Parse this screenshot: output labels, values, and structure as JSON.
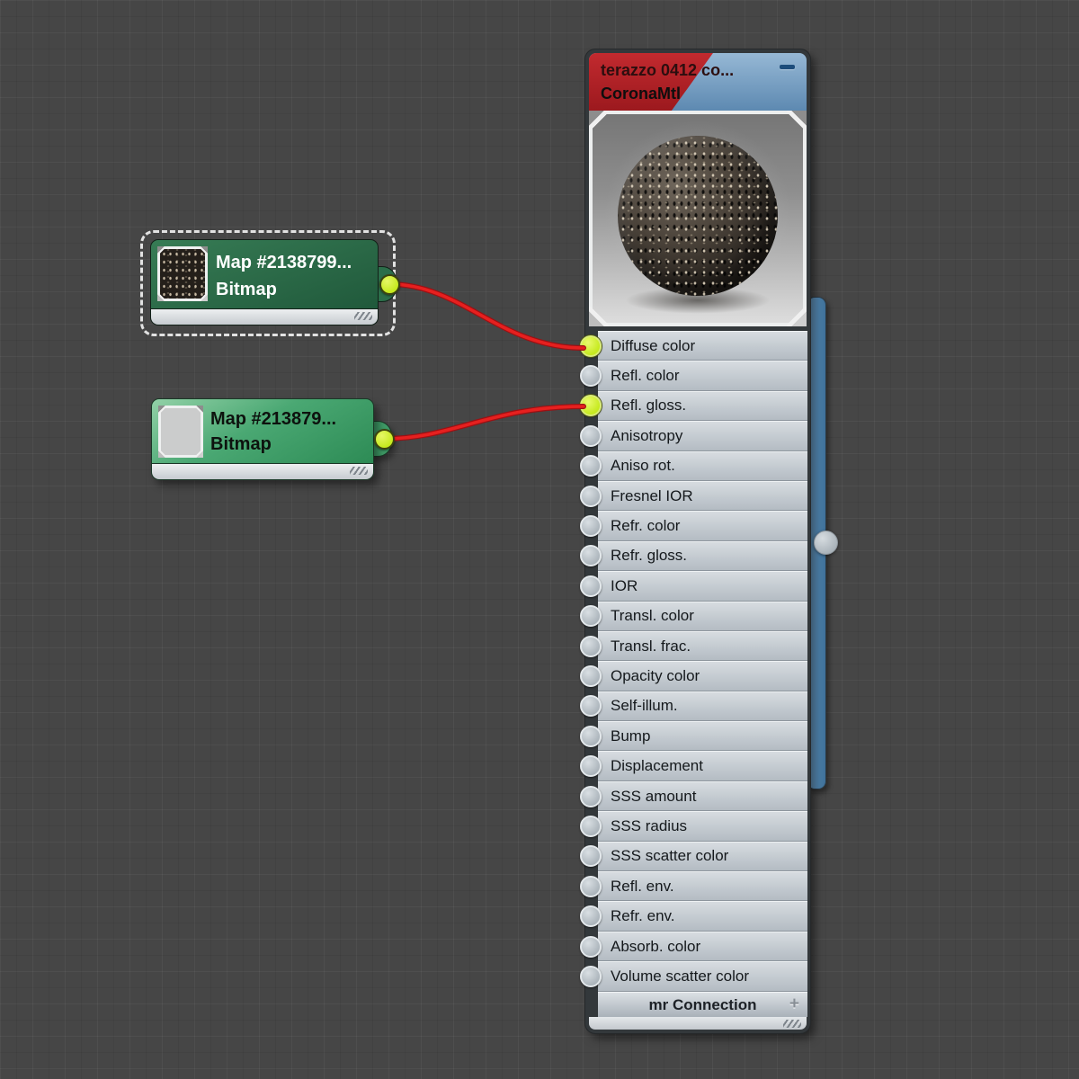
{
  "editor": {
    "background_color": "#464646",
    "grid": "on"
  },
  "material_node": {
    "title": "terazzo 0412 co...",
    "subtitle": "CoronaMtl",
    "collapse_icon": "minus",
    "header_colors": {
      "red": "#b02227",
      "blue": "#6f9cc3"
    },
    "preview": "dark-speckled-terrazzo-sphere",
    "slots": [
      {
        "label": "Diffuse color",
        "connected": true
      },
      {
        "label": "Refl. color",
        "connected": false
      },
      {
        "label": "Refl. gloss.",
        "connected": true
      },
      {
        "label": "Anisotropy",
        "connected": false
      },
      {
        "label": "Aniso rot.",
        "connected": false
      },
      {
        "label": "Fresnel IOR",
        "connected": false
      },
      {
        "label": "Refr. color",
        "connected": false
      },
      {
        "label": "Refr. gloss.",
        "connected": false
      },
      {
        "label": "IOR",
        "connected": false
      },
      {
        "label": "Transl. color",
        "connected": false
      },
      {
        "label": "Transl. frac.",
        "connected": false
      },
      {
        "label": "Opacity color",
        "connected": false
      },
      {
        "label": "Self-illum.",
        "connected": false
      },
      {
        "label": "Bump",
        "connected": false
      },
      {
        "label": "Displacement",
        "connected": false
      },
      {
        "label": "SSS amount",
        "connected": false
      },
      {
        "label": "SSS radius",
        "connected": false
      },
      {
        "label": "SSS scatter color",
        "connected": false
      },
      {
        "label": "Refl. env.",
        "connected": false
      },
      {
        "label": "Refr. env.",
        "connected": false
      },
      {
        "label": "Absorb. color",
        "connected": false
      },
      {
        "label": "Volume scatter color",
        "connected": false
      }
    ],
    "footer_bar": {
      "label": "mr Connection",
      "icon": "plus"
    },
    "output_socket": {
      "connected": false,
      "color": "#b3bbc2"
    }
  },
  "map_nodes": [
    {
      "title": "Map #2138799...",
      "subtitle": "Bitmap",
      "selected": true,
      "thumbnail": "dark-terrazzo-texture",
      "output_connected": true
    },
    {
      "title": "Map #213879...",
      "subtitle": "Bitmap",
      "selected": false,
      "thumbnail": "light-gray-blank",
      "output_connected": true
    }
  ],
  "connections": [
    {
      "from": "Map #2138799... Bitmap output",
      "to": "Diffuse color"
    },
    {
      "from": "Map #213879... Bitmap output",
      "to": "Refl. gloss."
    }
  ],
  "colors": {
    "wire": "#e01b1f",
    "socket_connected": "#c8ec28",
    "socket_default": "#b9c1c7",
    "side_tab": "#5a8fbb",
    "selected_node_green": "#2c6e4a",
    "unselected_node_green": "#4aa873"
  }
}
